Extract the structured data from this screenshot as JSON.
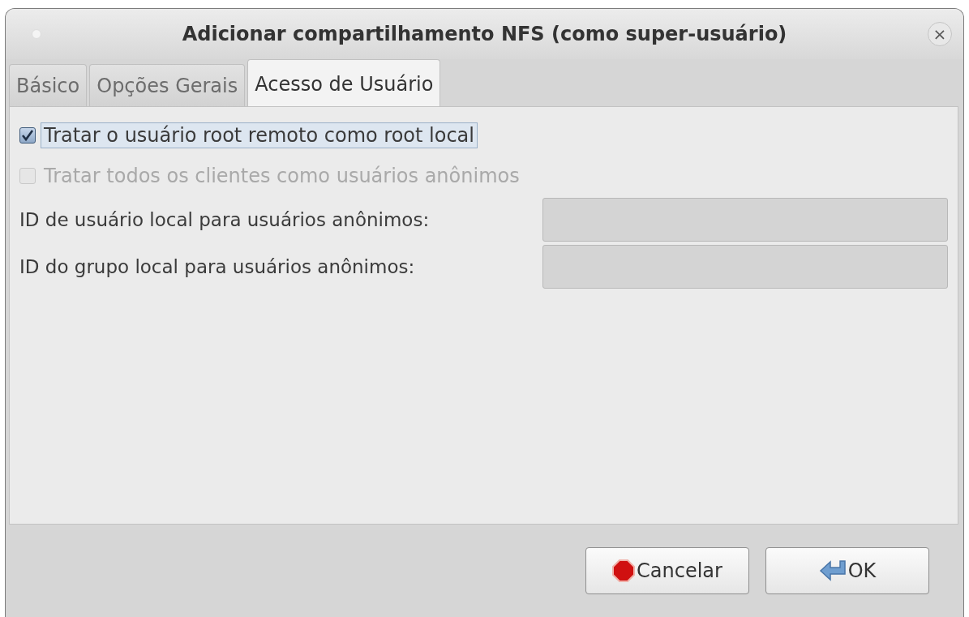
{
  "window": {
    "title": "Adicionar compartilhamento NFS (como super-usuário)",
    "close": "×"
  },
  "tabs": [
    {
      "label": "Básico",
      "selected": false
    },
    {
      "label": "Opções Gerais",
      "selected": false
    },
    {
      "label": "Acesso de Usuário",
      "selected": true
    }
  ],
  "options": [
    {
      "label": "Tratar o usuário root remoto como root local",
      "checked": true,
      "disabled": false,
      "focused": true
    },
    {
      "label": "Tratar todos os clientes como usuários anônimos",
      "checked": false,
      "disabled": true,
      "focused": false
    }
  ],
  "fields": [
    {
      "label": "ID de usuário local para usuários anônimos:",
      "disabled": true
    },
    {
      "label": "ID do grupo local para usuários anônimos:",
      "disabled": true
    }
  ],
  "buttons": [
    {
      "label": "Cancelar",
      "kind": "cancel"
    },
    {
      "label": "OK",
      "kind": "ok"
    }
  ]
}
